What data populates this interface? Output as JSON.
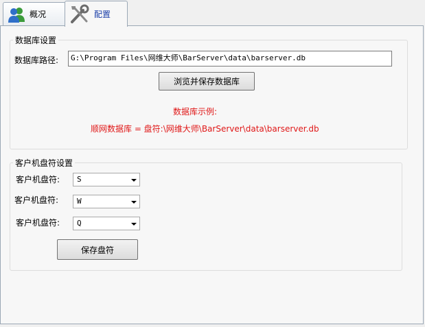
{
  "tabs": [
    {
      "label": "概况",
      "icon": "users-icon"
    },
    {
      "label": "配置",
      "icon": "tools-icon"
    }
  ],
  "database_group": {
    "title": "数据库设置",
    "path_label": "数据库路径:",
    "path_value": "G:\\Program Files\\网维大师\\BarServer\\data\\barserver.db",
    "browse_button": "浏览并保存数据库",
    "example_heading": "数据库示例:",
    "example_text": "顺网数据库 =  盘符:\\网维大师\\BarServer\\data\\barserver.db"
  },
  "client_group": {
    "title": "客户机盘符设置",
    "rows": [
      {
        "label": "客户机盘符:",
        "value": "S"
      },
      {
        "label": "客户机盘符:",
        "value": "W"
      },
      {
        "label": "客户机盘符:",
        "value": "Q"
      }
    ],
    "save_button": "保存盘符"
  },
  "colors": {
    "accent_red": "#e01818",
    "tab_link_blue": "#1a3ea8"
  }
}
